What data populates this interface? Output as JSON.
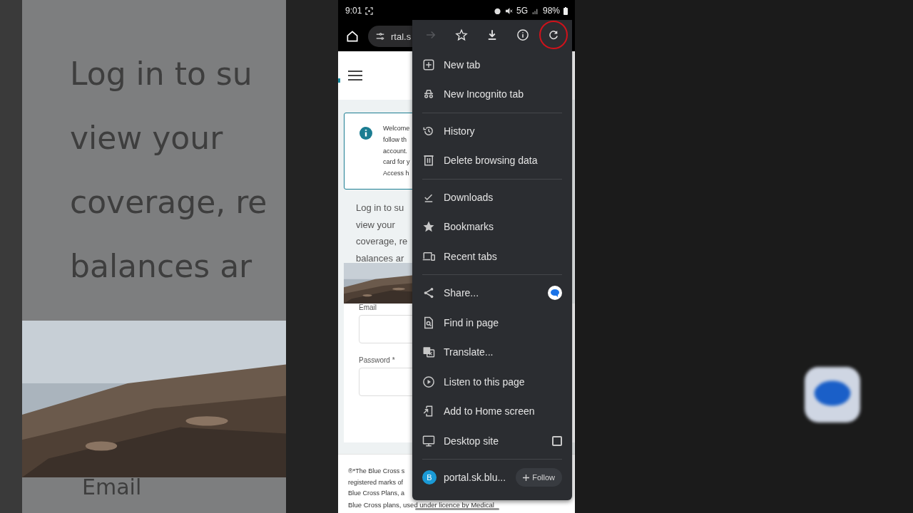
{
  "backdrop": {
    "lines": [
      "Log in to su",
      "view your",
      "coverage, re",
      "balances ar"
    ],
    "email_label": "Email"
  },
  "status_bar": {
    "time": "9:01",
    "network": "5G",
    "battery": "98%"
  },
  "toolbar": {
    "url": "rtal.s"
  },
  "page": {
    "info_lines": [
      "Welcome",
      "follow th",
      "account.",
      "card for y",
      "Access h"
    ],
    "intro_lines": [
      "Log in to su",
      "view your",
      "coverage, re",
      "balances ar"
    ],
    "email_label": "Email",
    "password_label": "Password *",
    "footer_lines": [
      "®*The Blue Cross s",
      "registered marks of",
      "Blue Cross Plans, a",
      "Blue Cross plans, used under licence by Medical"
    ]
  },
  "menu": {
    "actions": [
      {
        "kind": "forward",
        "disabled": true,
        "circled": false
      },
      {
        "kind": "star",
        "disabled": false,
        "circled": false
      },
      {
        "kind": "download",
        "disabled": false,
        "circled": false
      },
      {
        "kind": "info",
        "disabled": false,
        "circled": false
      },
      {
        "kind": "refresh",
        "disabled": false,
        "circled": true
      }
    ],
    "groups": [
      [
        {
          "label": "New tab",
          "kind": "plain"
        },
        {
          "label": "New Incognito tab",
          "kind": "plain"
        }
      ],
      [
        {
          "label": "History",
          "kind": "plain"
        },
        {
          "label": "Delete browsing data",
          "kind": "plain"
        }
      ],
      [
        {
          "label": "Downloads",
          "kind": "plain"
        },
        {
          "label": "Bookmarks",
          "kind": "plain"
        },
        {
          "label": "Recent tabs",
          "kind": "plain"
        }
      ],
      [
        {
          "label": "Share...",
          "kind": "share"
        },
        {
          "label": "Find in page",
          "kind": "plain"
        },
        {
          "label": "Translate...",
          "kind": "plain"
        },
        {
          "label": "Listen to this page",
          "kind": "plain"
        },
        {
          "label": "Add to Home screen",
          "kind": "plain"
        },
        {
          "label": "Desktop site",
          "kind": "toggle",
          "checked": false
        }
      ]
    ],
    "site": {
      "initial": "B",
      "name": "portal.sk.blu...",
      "follow": "Follow"
    }
  }
}
